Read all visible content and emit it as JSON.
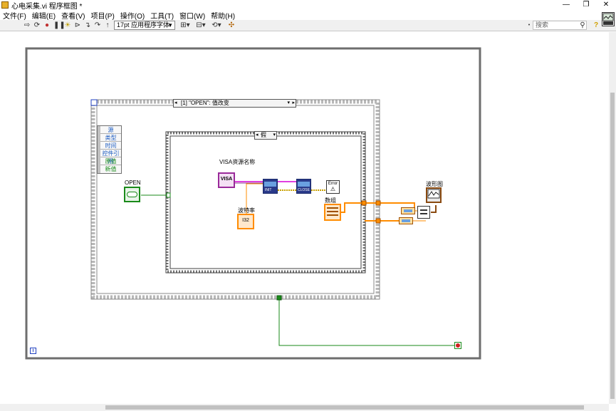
{
  "window": {
    "title": "心电采集.vi 程序框图 *",
    "controls": [
      "—",
      "❐",
      "✕"
    ]
  },
  "menu": [
    "文件(F)",
    "编辑(E)",
    "查看(V)",
    "项目(P)",
    "操作(O)",
    "工具(T)",
    "窗口(W)",
    "帮助(H)"
  ],
  "toolbar": {
    "font": "17pt 应用程序字体",
    "search_placeholder": "搜索"
  },
  "diagram": {
    "event_case_label": "[1] \"OPEN\": 值改变",
    "inner_case_label": "假",
    "event_data_items": [
      "源",
      "类型",
      "时间",
      "控件引用",
      "原值",
      "新值"
    ],
    "open_label": "OPEN",
    "visa_label": "VISA资源名称",
    "visa_short": "VISA",
    "baud_label": "波特率",
    "baud_value": "I32",
    "array_label": "数组",
    "waveform_label": "波形图",
    "init_label": "INIT",
    "close_label": "CLOSE",
    "error_label": "Error",
    "info_icon": "i"
  },
  "colors": {
    "pink_wire": "#e040e0",
    "orange_wire": "#ff8c00",
    "green_wire": "#1a8a1a",
    "error_wire": "#c8a000",
    "frame": "#707070"
  }
}
